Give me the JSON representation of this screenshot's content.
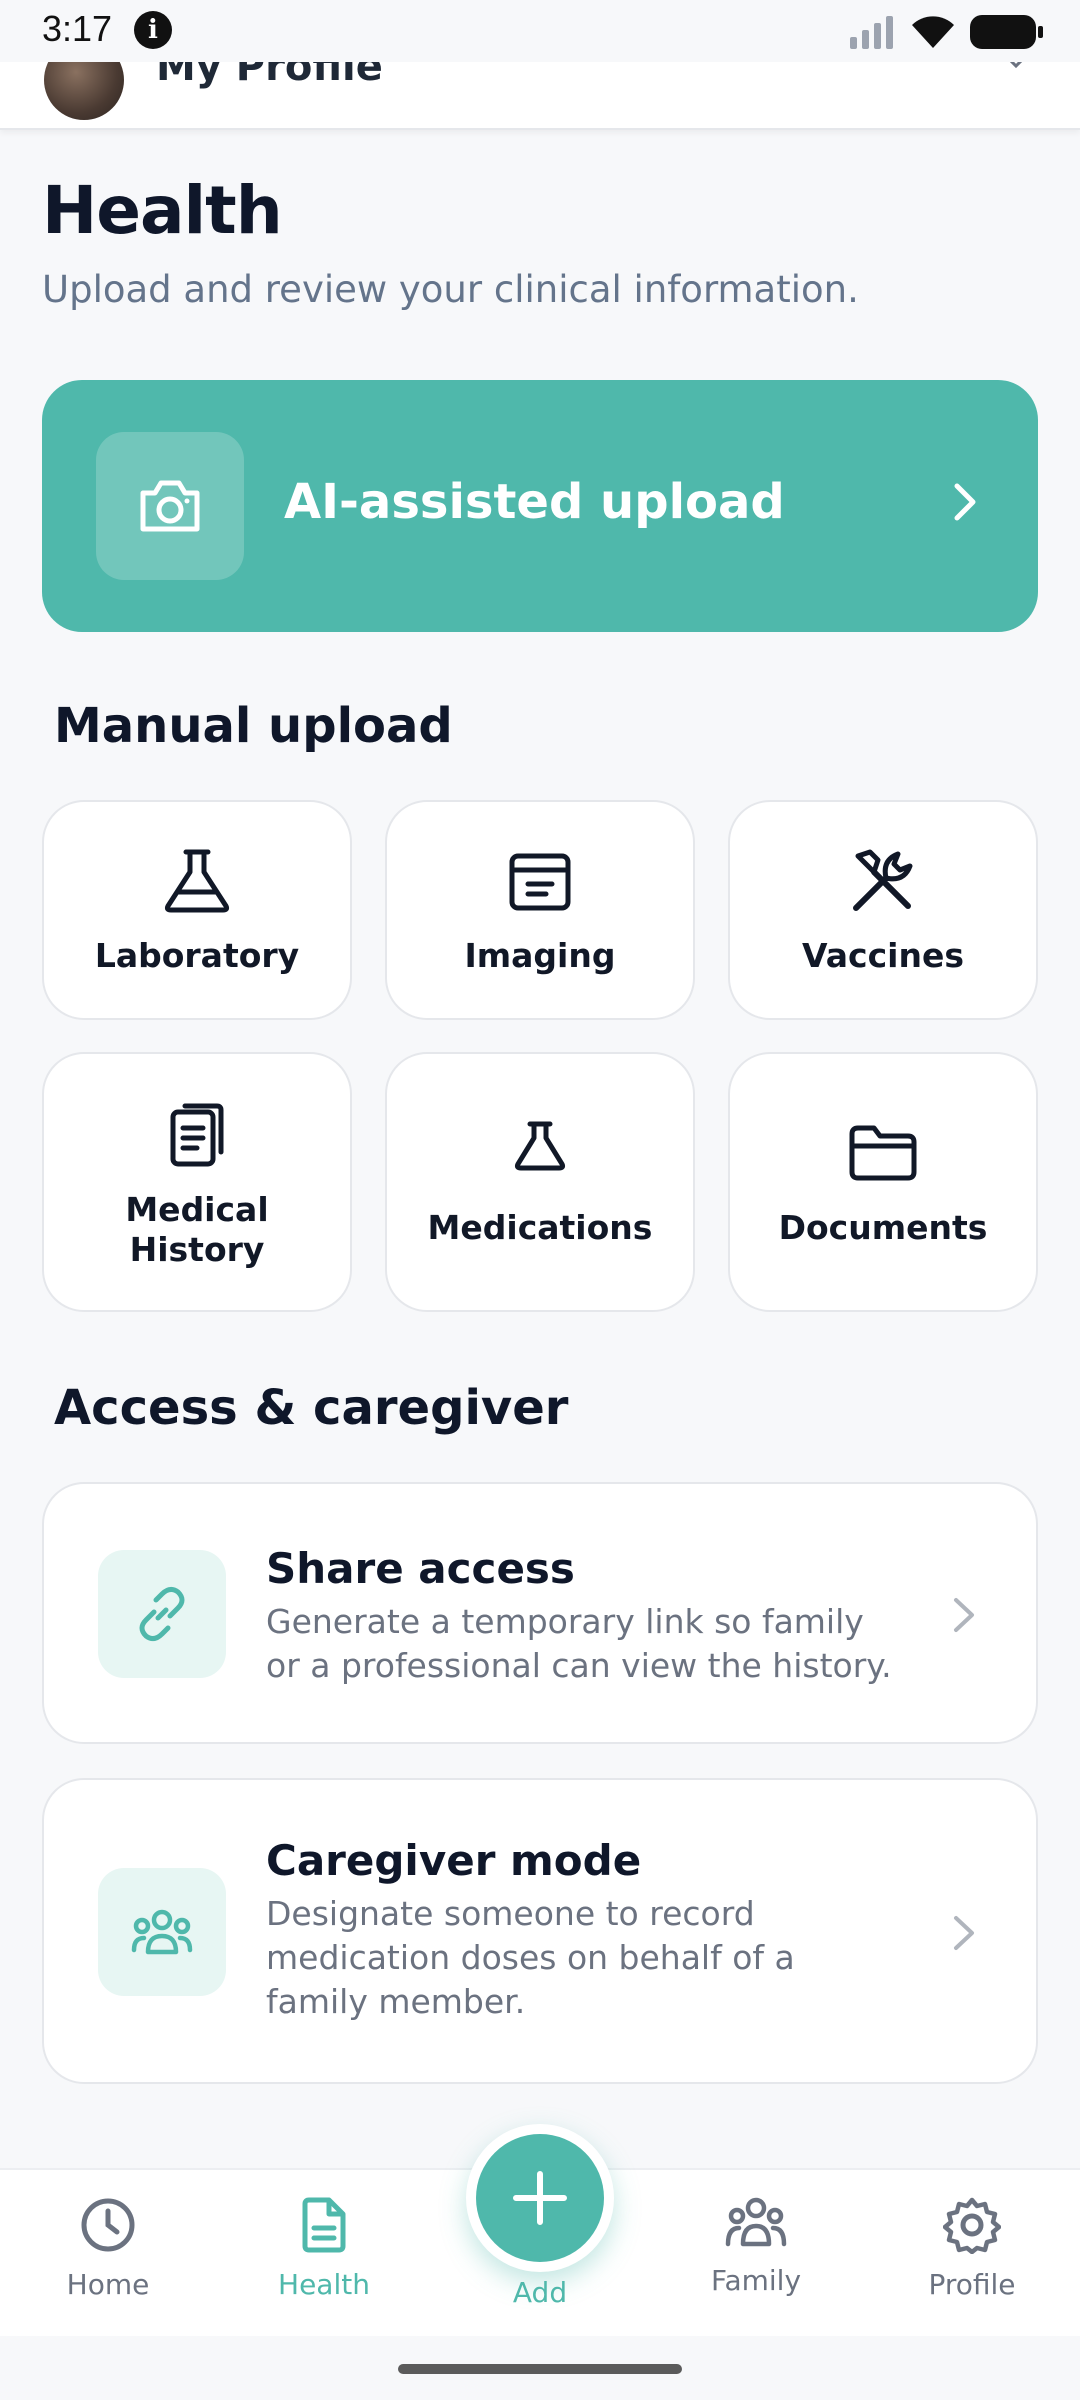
{
  "status_bar": {
    "time": "3:17"
  },
  "profile_header": {
    "name": "My Profile"
  },
  "page": {
    "title": "Health",
    "subtitle": "Upload and review your clinical information."
  },
  "ai_upload": {
    "label": "AI-assisted upload",
    "icon": "camera-icon"
  },
  "manual_upload": {
    "title": "Manual upload",
    "items": [
      {
        "label": "Laboratory",
        "icon": "flask-icon"
      },
      {
        "label": "Imaging",
        "icon": "imaging-archive-icon"
      },
      {
        "label": "Vaccines",
        "icon": "tools-icon"
      },
      {
        "label": "Medical History",
        "line1": "Medical",
        "line2": "History",
        "icon": "clipboard-icon"
      },
      {
        "label": "Medications",
        "icon": "small-flask-icon"
      },
      {
        "label": "Documents",
        "icon": "folder-icon"
      }
    ]
  },
  "access": {
    "title": "Access & caregiver",
    "items": [
      {
        "title": "Share access",
        "desc": "Generate a temporary link so family or a professional can view the history.",
        "icon": "link-icon"
      },
      {
        "title": "Caregiver mode",
        "desc": "Designate someone to record medication doses on behalf of a family member.",
        "icon": "group-icon"
      }
    ]
  },
  "bottom_nav": {
    "items": [
      {
        "label": "Home",
        "icon": "clock-icon",
        "active": false
      },
      {
        "label": "Health",
        "icon": "document-icon",
        "active": true
      },
      {
        "label": "Add",
        "icon": "plus-icon",
        "active": false
      },
      {
        "label": "Family",
        "icon": "family-icon",
        "active": false
      },
      {
        "label": "Profile",
        "icon": "gear-icon",
        "active": false
      }
    ]
  },
  "colors": {
    "accent": "#4fb8ab",
    "accent_light": "#e7f6f3",
    "text": "#0f172a",
    "muted": "#6b7280"
  }
}
